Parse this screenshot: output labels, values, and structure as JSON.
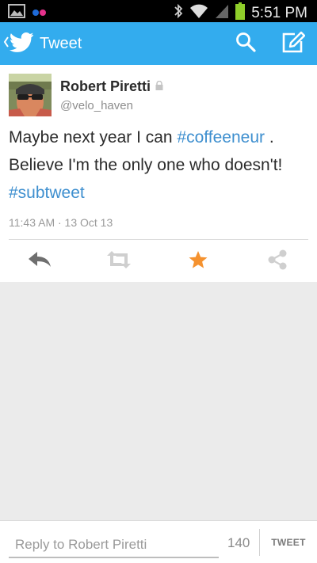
{
  "status_bar": {
    "time": "5:51 PM"
  },
  "action_bar": {
    "title": "Tweet"
  },
  "tweet": {
    "author_name": "Robert Piretti",
    "author_handle": "@velo_haven",
    "text_part1": "Maybe next year I can ",
    "hashtag1": "#coffeeneur",
    "text_part2": " . Believe I'm the only one who doesn't! ",
    "hashtag2": "#subtweet",
    "timestamp": "11:43 AM · 13 Oct 13"
  },
  "composer": {
    "placeholder": "Reply to Robert Piretti",
    "char_count": "140",
    "send_label": "TWEET"
  },
  "colors": {
    "accent": "#33acee",
    "favorite": "#f5922f",
    "link": "#3e8fcf"
  }
}
